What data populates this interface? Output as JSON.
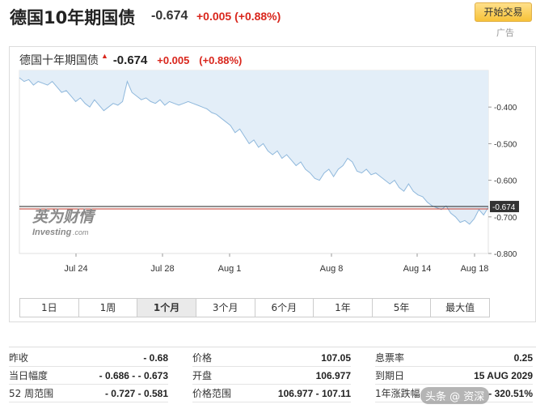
{
  "header": {
    "title": "德国10年期国债",
    "price": "-0.674",
    "change": "+0.005 (+0.88%)",
    "trade_button": "开始交易",
    "ad_label": "广告"
  },
  "chart": {
    "name": "德国十年期国债",
    "price": "-0.674",
    "change": "+0.005",
    "change_pct": "(+0.88%)",
    "watermark_cn": "英为财情",
    "watermark_en": "Investing",
    "watermark_dot": ".com"
  },
  "range_buttons": [
    "1日",
    "1周",
    "1个月",
    "3个月",
    "6个月",
    "1年",
    "5年",
    "最大值"
  ],
  "range_active": "1个月",
  "stats": {
    "col1": [
      {
        "label": "昨收",
        "value": "- 0.68"
      },
      {
        "label": "当日幅度",
        "value": "- 0.686 - - 0.673"
      },
      {
        "label": "52 周范围",
        "value": "- 0.727 - 0.581"
      }
    ],
    "col2": [
      {
        "label": "价格",
        "value": "107.05"
      },
      {
        "label": "开盘",
        "value": "106.977"
      },
      {
        "label": "价格范围",
        "value": "106.977 - 107.11"
      }
    ],
    "col3": [
      {
        "label": "息票率",
        "value": "0.25"
      },
      {
        "label": "到期日",
        "value": "15 AUG 2029"
      },
      {
        "label": "1年涨跌幅",
        "value": "- 320.51%"
      }
    ]
  },
  "overlay_watermark": "头条 @ 资深",
  "chart_data": {
    "type": "area",
    "x_ticks": [
      "Jul 24",
      "Jul 28",
      "Aug 1",
      "Aug 8",
      "Aug 14",
      "Aug 18"
    ],
    "y_ticks": [
      "-0.400",
      "-0.500",
      "-0.600",
      "-0.700",
      "-0.800"
    ],
    "ylim": [
      -0.8,
      -0.4
    ],
    "current_label": "-0.674",
    "values": [
      -0.32,
      -0.33,
      -0.325,
      -0.34,
      -0.33,
      -0.335,
      -0.34,
      -0.33,
      -0.345,
      -0.36,
      -0.355,
      -0.37,
      -0.385,
      -0.375,
      -0.39,
      -0.4,
      -0.38,
      -0.395,
      -0.41,
      -0.4,
      -0.39,
      -0.395,
      -0.385,
      -0.33,
      -0.36,
      -0.37,
      -0.38,
      -0.375,
      -0.385,
      -0.39,
      -0.38,
      -0.395,
      -0.385,
      -0.39,
      -0.395,
      -0.39,
      -0.385,
      -0.39,
      -0.395,
      -0.4,
      -0.405,
      -0.415,
      -0.42,
      -0.43,
      -0.44,
      -0.45,
      -0.47,
      -0.46,
      -0.48,
      -0.5,
      -0.49,
      -0.51,
      -0.5,
      -0.52,
      -0.53,
      -0.52,
      -0.54,
      -0.53,
      -0.545,
      -0.56,
      -0.55,
      -0.57,
      -0.58,
      -0.595,
      -0.6,
      -0.58,
      -0.57,
      -0.59,
      -0.57,
      -0.56,
      -0.54,
      -0.55,
      -0.575,
      -0.58,
      -0.57,
      -0.585,
      -0.58,
      -0.59,
      -0.6,
      -0.61,
      -0.6,
      -0.62,
      -0.63,
      -0.61,
      -0.63,
      -0.64,
      -0.645,
      -0.66,
      -0.67,
      -0.675,
      -0.68,
      -0.67,
      -0.69,
      -0.7,
      -0.715,
      -0.71,
      -0.72,
      -0.705,
      -0.68,
      -0.695,
      -0.674
    ],
    "colors": {
      "line": "#8fb8dc",
      "fill": "#e3eef8",
      "ref_black": "#222222",
      "ref_red": "#c0392b"
    }
  }
}
